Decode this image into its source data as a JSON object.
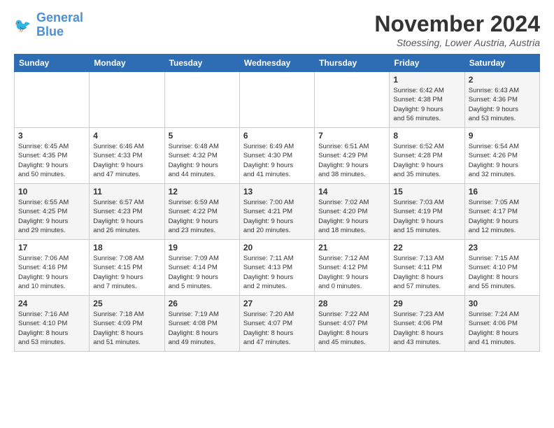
{
  "logo": {
    "line1": "General",
    "line2": "Blue"
  },
  "title": "November 2024",
  "location": "Stoessing, Lower Austria, Austria",
  "headers": [
    "Sunday",
    "Monday",
    "Tuesday",
    "Wednesday",
    "Thursday",
    "Friday",
    "Saturday"
  ],
  "weeks": [
    [
      {
        "day": "",
        "info": ""
      },
      {
        "day": "",
        "info": ""
      },
      {
        "day": "",
        "info": ""
      },
      {
        "day": "",
        "info": ""
      },
      {
        "day": "",
        "info": ""
      },
      {
        "day": "1",
        "info": "Sunrise: 6:42 AM\nSunset: 4:38 PM\nDaylight: 9 hours\nand 56 minutes."
      },
      {
        "day": "2",
        "info": "Sunrise: 6:43 AM\nSunset: 4:36 PM\nDaylight: 9 hours\nand 53 minutes."
      }
    ],
    [
      {
        "day": "3",
        "info": "Sunrise: 6:45 AM\nSunset: 4:35 PM\nDaylight: 9 hours\nand 50 minutes."
      },
      {
        "day": "4",
        "info": "Sunrise: 6:46 AM\nSunset: 4:33 PM\nDaylight: 9 hours\nand 47 minutes."
      },
      {
        "day": "5",
        "info": "Sunrise: 6:48 AM\nSunset: 4:32 PM\nDaylight: 9 hours\nand 44 minutes."
      },
      {
        "day": "6",
        "info": "Sunrise: 6:49 AM\nSunset: 4:30 PM\nDaylight: 9 hours\nand 41 minutes."
      },
      {
        "day": "7",
        "info": "Sunrise: 6:51 AM\nSunset: 4:29 PM\nDaylight: 9 hours\nand 38 minutes."
      },
      {
        "day": "8",
        "info": "Sunrise: 6:52 AM\nSunset: 4:28 PM\nDaylight: 9 hours\nand 35 minutes."
      },
      {
        "day": "9",
        "info": "Sunrise: 6:54 AM\nSunset: 4:26 PM\nDaylight: 9 hours\nand 32 minutes."
      }
    ],
    [
      {
        "day": "10",
        "info": "Sunrise: 6:55 AM\nSunset: 4:25 PM\nDaylight: 9 hours\nand 29 minutes."
      },
      {
        "day": "11",
        "info": "Sunrise: 6:57 AM\nSunset: 4:23 PM\nDaylight: 9 hours\nand 26 minutes."
      },
      {
        "day": "12",
        "info": "Sunrise: 6:59 AM\nSunset: 4:22 PM\nDaylight: 9 hours\nand 23 minutes."
      },
      {
        "day": "13",
        "info": "Sunrise: 7:00 AM\nSunset: 4:21 PM\nDaylight: 9 hours\nand 20 minutes."
      },
      {
        "day": "14",
        "info": "Sunrise: 7:02 AM\nSunset: 4:20 PM\nDaylight: 9 hours\nand 18 minutes."
      },
      {
        "day": "15",
        "info": "Sunrise: 7:03 AM\nSunset: 4:19 PM\nDaylight: 9 hours\nand 15 minutes."
      },
      {
        "day": "16",
        "info": "Sunrise: 7:05 AM\nSunset: 4:17 PM\nDaylight: 9 hours\nand 12 minutes."
      }
    ],
    [
      {
        "day": "17",
        "info": "Sunrise: 7:06 AM\nSunset: 4:16 PM\nDaylight: 9 hours\nand 10 minutes."
      },
      {
        "day": "18",
        "info": "Sunrise: 7:08 AM\nSunset: 4:15 PM\nDaylight: 9 hours\nand 7 minutes."
      },
      {
        "day": "19",
        "info": "Sunrise: 7:09 AM\nSunset: 4:14 PM\nDaylight: 9 hours\nand 5 minutes."
      },
      {
        "day": "20",
        "info": "Sunrise: 7:11 AM\nSunset: 4:13 PM\nDaylight: 9 hours\nand 2 minutes."
      },
      {
        "day": "21",
        "info": "Sunrise: 7:12 AM\nSunset: 4:12 PM\nDaylight: 9 hours\nand 0 minutes."
      },
      {
        "day": "22",
        "info": "Sunrise: 7:13 AM\nSunset: 4:11 PM\nDaylight: 8 hours\nand 57 minutes."
      },
      {
        "day": "23",
        "info": "Sunrise: 7:15 AM\nSunset: 4:10 PM\nDaylight: 8 hours\nand 55 minutes."
      }
    ],
    [
      {
        "day": "24",
        "info": "Sunrise: 7:16 AM\nSunset: 4:10 PM\nDaylight: 8 hours\nand 53 minutes."
      },
      {
        "day": "25",
        "info": "Sunrise: 7:18 AM\nSunset: 4:09 PM\nDaylight: 8 hours\nand 51 minutes."
      },
      {
        "day": "26",
        "info": "Sunrise: 7:19 AM\nSunset: 4:08 PM\nDaylight: 8 hours\nand 49 minutes."
      },
      {
        "day": "27",
        "info": "Sunrise: 7:20 AM\nSunset: 4:07 PM\nDaylight: 8 hours\nand 47 minutes."
      },
      {
        "day": "28",
        "info": "Sunrise: 7:22 AM\nSunset: 4:07 PM\nDaylight: 8 hours\nand 45 minutes."
      },
      {
        "day": "29",
        "info": "Sunrise: 7:23 AM\nSunset: 4:06 PM\nDaylight: 8 hours\nand 43 minutes."
      },
      {
        "day": "30",
        "info": "Sunrise: 7:24 AM\nSunset: 4:06 PM\nDaylight: 8 hours\nand 41 minutes."
      }
    ]
  ]
}
